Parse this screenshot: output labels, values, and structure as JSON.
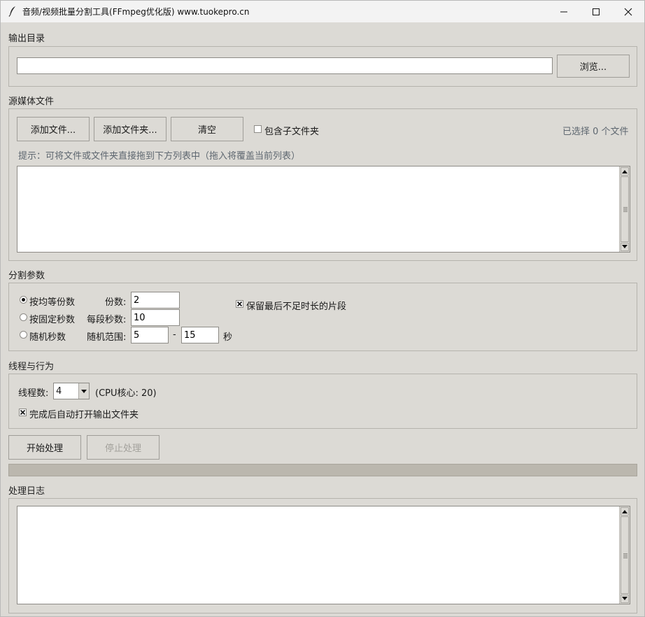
{
  "window": {
    "title": "音频/视频批量分割工具(FFmpeg优化版) www.tuokepro.cn"
  },
  "output": {
    "section_label": "输出目录",
    "path_value": "",
    "browse_label": "浏览..."
  },
  "source": {
    "section_label": "源媒体文件",
    "add_files_label": "添加文件...",
    "add_folder_label": "添加文件夹...",
    "clear_label": "清空",
    "include_subfolders_label": "包含子文件夹",
    "include_subfolders_checked": false,
    "selected_count_text": "已选择 0 个文件",
    "hint_text": "提示：可将文件或文件夹直接拖到下方列表中（拖入将覆盖当前列表）",
    "files": []
  },
  "split": {
    "section_label": "分割参数",
    "mode_equal_label": "按均等份数",
    "mode_fixed_label": "按固定秒数",
    "mode_random_label": "随机秒数",
    "selected_mode": "equal",
    "parts_label": "份数:",
    "parts_value": "2",
    "seconds_label": "每段秒数:",
    "seconds_value": "10",
    "random_label": "随机范围:",
    "random_min": "5",
    "random_sep": "-",
    "random_max": "15",
    "random_unit": "秒",
    "keep_last_label": "保留最后不足时长的片段",
    "keep_last_checked": true
  },
  "threads": {
    "section_label": "线程与行为",
    "threads_label": "线程数:",
    "threads_value": "4",
    "cpu_info": "(CPU核心: 20)",
    "auto_open_label": "完成后自动打开输出文件夹",
    "auto_open_checked": true
  },
  "actions": {
    "start_label": "开始处理",
    "stop_label": "停止处理"
  },
  "progress": {
    "value": 0
  },
  "log": {
    "section_label": "处理日志",
    "content": ""
  },
  "icons": {
    "app": "feather-icon",
    "minimize": "minimize-icon",
    "maximize": "maximize-icon",
    "close": "close-icon"
  }
}
